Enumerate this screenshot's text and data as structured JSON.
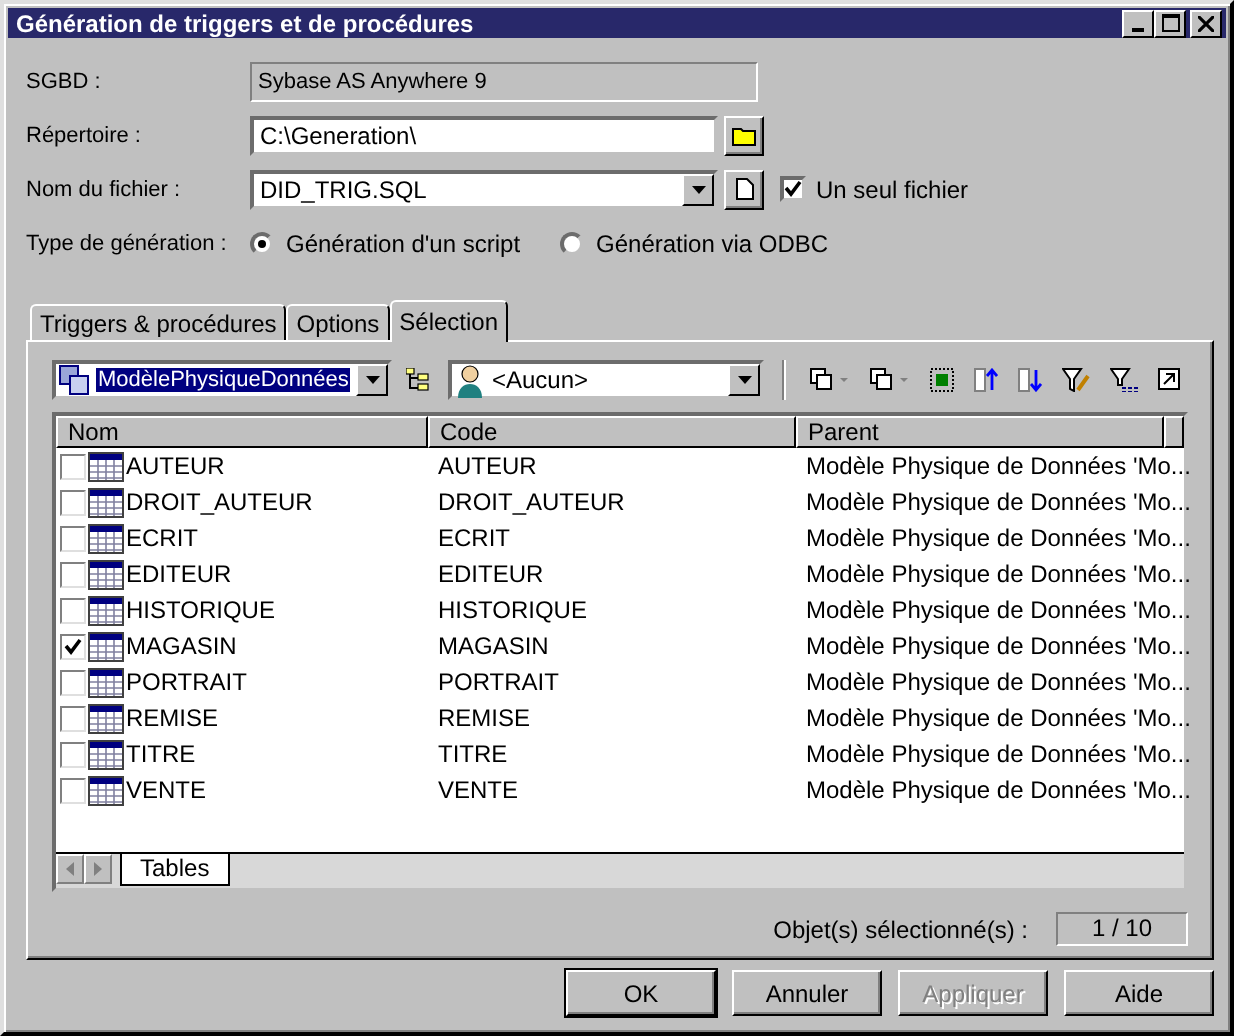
{
  "window": {
    "title": "Génération de triggers et de procédures"
  },
  "sgbd": {
    "label": "SGBD :",
    "value": "Sybase AS Anywhere 9"
  },
  "directory": {
    "label": "Répertoire :",
    "value": "C:\\Generation\\"
  },
  "filename": {
    "label": "Nom du fichier :",
    "value": "DID_TRIG.SQL",
    "single_file": {
      "label": "Un seul fichier",
      "checked": true
    }
  },
  "generation_type": {
    "label": "Type de génération :",
    "options": [
      {
        "label": "Génération d'un script",
        "selected": true
      },
      {
        "label": "Génération via ODBC",
        "selected": false
      }
    ]
  },
  "tabs": [
    {
      "label": "Triggers & procédures",
      "selected": false
    },
    {
      "label": "Options",
      "selected": false
    },
    {
      "label": "Sélection",
      "selected": true
    }
  ],
  "model_select": {
    "value": "ModèlePhysiqueDonnées"
  },
  "owner_select": {
    "value": "<Aucun>"
  },
  "table": {
    "columns": [
      "Nom",
      "Code",
      "Parent"
    ],
    "rows": [
      {
        "name": "AUTEUR",
        "code": "AUTEUR",
        "parent": "Modèle Physique de Données 'Mo...",
        "checked": false
      },
      {
        "name": "DROIT_AUTEUR",
        "code": "DROIT_AUTEUR",
        "parent": "Modèle Physique de Données 'Mo...",
        "checked": false
      },
      {
        "name": "ECRIT",
        "code": "ECRIT",
        "parent": "Modèle Physique de Données 'Mo...",
        "checked": false
      },
      {
        "name": "EDITEUR",
        "code": "EDITEUR",
        "parent": "Modèle Physique de Données 'Mo...",
        "checked": false
      },
      {
        "name": "HISTORIQUE",
        "code": "HISTORIQUE",
        "parent": "Modèle Physique de Données 'Mo...",
        "checked": false
      },
      {
        "name": "MAGASIN",
        "code": "MAGASIN",
        "parent": "Modèle Physique de Données 'Mo...",
        "checked": true
      },
      {
        "name": "PORTRAIT",
        "code": "PORTRAIT",
        "parent": "Modèle Physique de Données 'Mo...",
        "checked": false
      },
      {
        "name": "REMISE",
        "code": "REMISE",
        "parent": "Modèle Physique de Données 'Mo...",
        "checked": false
      },
      {
        "name": "TITRE",
        "code": "TITRE",
        "parent": "Modèle Physique de Données 'Mo...",
        "checked": false
      },
      {
        "name": "VENTE",
        "code": "VENTE",
        "parent": "Modèle Physique de Données 'Mo...",
        "checked": false
      }
    ]
  },
  "sheet_tabs": [
    {
      "label": "Tables",
      "selected": true
    }
  ],
  "selection_count": {
    "label": "Objet(s) sélectionné(s) :",
    "value": "1 / 10"
  },
  "buttons": [
    {
      "label": "OK",
      "kind": "default",
      "disabled": false
    },
    {
      "label": "Annuler",
      "kind": "normal",
      "disabled": false
    },
    {
      "label": "Appliquer",
      "kind": "normal",
      "disabled": true
    },
    {
      "label": "Aide",
      "kind": "normal",
      "disabled": false
    }
  ]
}
